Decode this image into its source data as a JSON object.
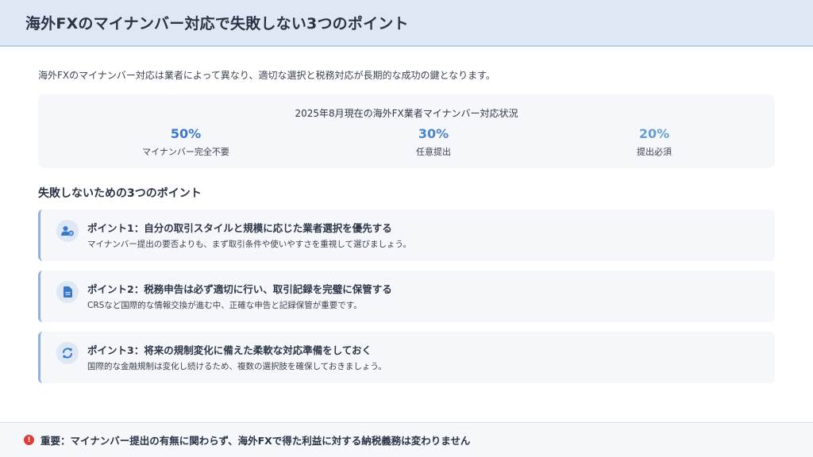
{
  "header": {
    "title": "海外FXのマイナンバー対応で失敗しない3つのポイント"
  },
  "intro": "海外FXのマイナンバー対応は業者によって異なり、適切な選択と税務対応が長期的な成功の鍵となります。",
  "stats": {
    "title": "2025年8月現在の海外FX業者マイナンバー対応状況",
    "items": [
      {
        "value": "50%",
        "label": "マイナンバー完全不要",
        "color": "#3a78c9"
      },
      {
        "value": "30%",
        "label": "任意提出",
        "color": "#4a84c9"
      },
      {
        "value": "20%",
        "label": "提出必須",
        "color": "#6a9dd6"
      }
    ]
  },
  "section_title": "失敗しないための3つのポイント",
  "points": [
    {
      "icon": "user-gear-icon",
      "title": "ポイント1：自分の取引スタイルと規模に応じた業者選択を優先する",
      "desc": "マイナンバー提出の要否よりも、まず取引条件や使いやすさを重視して選びましょう。"
    },
    {
      "icon": "document-icon",
      "title": "ポイント2：税務申告は必ず適切に行い、取引記録を完璧に保管する",
      "desc": "CRSなど国際的な情報交換が進む中、正確な申告と記録保管が重要です。"
    },
    {
      "icon": "refresh-icon",
      "title": "ポイント3：将来の規制変化に備えた柔軟な対応準備をしておく",
      "desc": "国際的な金融規制は変化し続けるため、複数の選択肢を確保しておきましょう。"
    }
  ],
  "footer": {
    "icon_label": "!",
    "text": "重要：マイナンバー提出の有無に関わらず、海外FXで得た利益に対する納税義務は変わりません"
  }
}
